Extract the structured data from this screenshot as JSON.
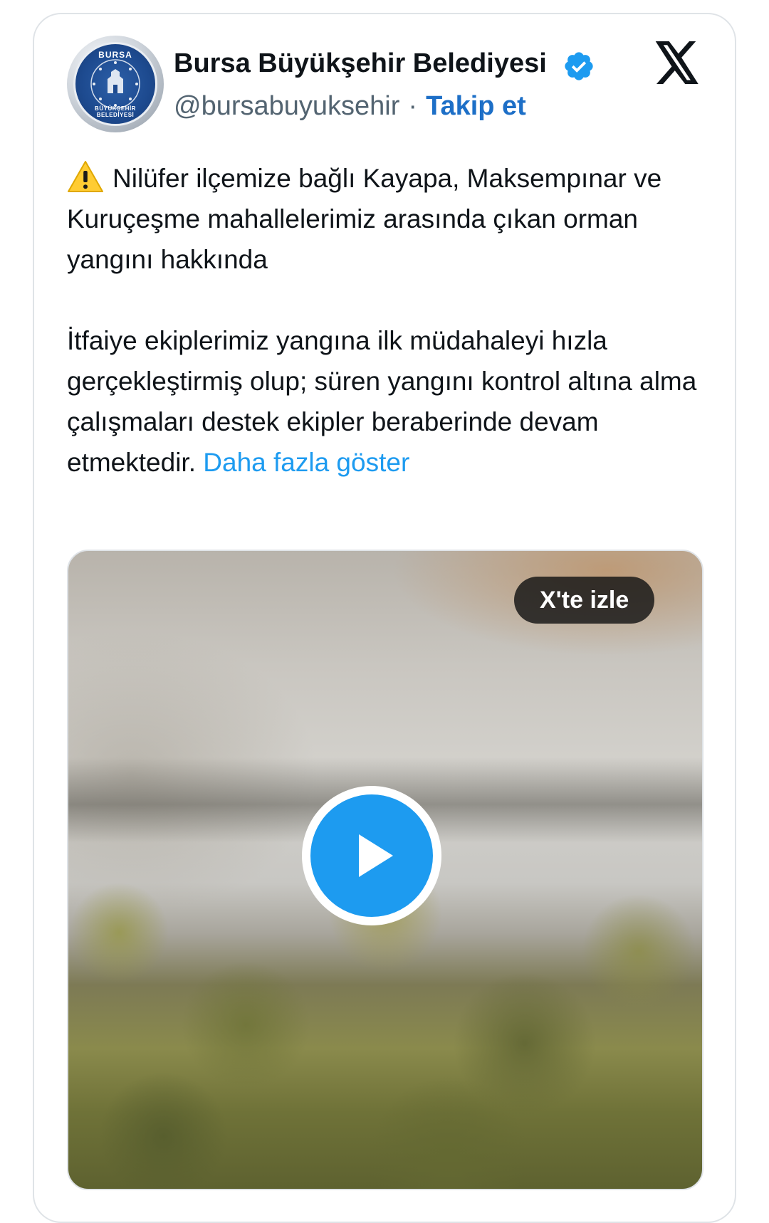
{
  "author": {
    "name": "Bursa Büyükşehir Belediyesi",
    "handle": "@bursabuyuksehir",
    "separator": "·",
    "follow_label": "Takip et",
    "avatar_text_top": "BURSA",
    "avatar_text_bottom": "BÜYÜKŞEHİR BELEDİYESİ",
    "verified_icon": "verified-badge-icon"
  },
  "platform_icon": "x-logo-icon",
  "tweet": {
    "warning_icon": "warning-icon",
    "paragraph_1": "Nilüfer ilçemize bağlı Kayapa, Maksempınar ve Kuruçeşme mahallelerimiz arasında çıkan orman yangını hakkında",
    "paragraph_2": "İtfaiye ekiplerimiz yangına ilk müdahaleyi hızla gerçekleştirmiş olup; süren yangını kontrol altına alma çalışmaları destek ekipler beraberinde devam etmektedir.",
    "show_more_label": "Daha fazla göster"
  },
  "media": {
    "watch_label": "X'te izle",
    "play_icon": "play-icon"
  },
  "colors": {
    "accent": "#1d9bf0",
    "follow": "#1d6fc7",
    "text": "#0f1419",
    "muted": "#536471",
    "border": "#dfe3e7"
  }
}
